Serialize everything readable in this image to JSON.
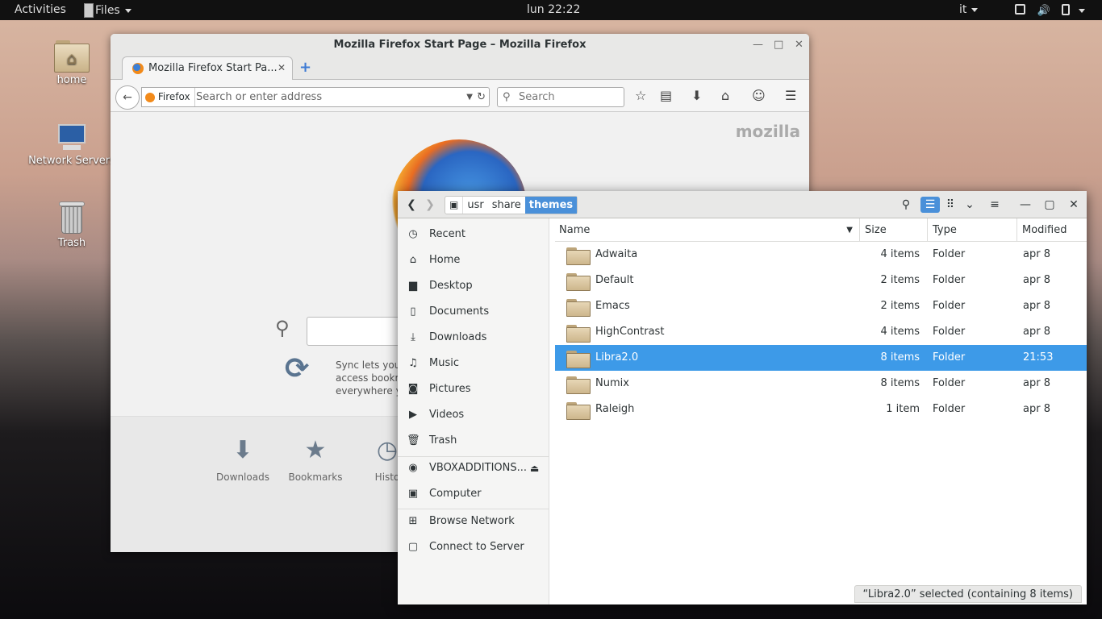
{
  "topbar": {
    "activities": "Activities",
    "app_menu": "Files",
    "clock": "lun 22:22",
    "lang": "it"
  },
  "desktop": {
    "icons": [
      {
        "label": "home"
      },
      {
        "label": "Network Servers"
      },
      {
        "label": "Trash"
      }
    ]
  },
  "firefox": {
    "title": "Mozilla Firefox Start Page – Mozilla Firefox",
    "tab_label": "Mozilla Firefox Start Pa...",
    "identity": "Firefox",
    "url_placeholder": "Search or enter address",
    "search_placeholder": "Search",
    "brand": "mozilla",
    "sync_text": [
      "Sync lets you s",
      "access bookma",
      "everywhere yo"
    ],
    "launchers": [
      "Downloads",
      "Bookmarks",
      "Histo"
    ]
  },
  "files": {
    "path": [
      "usr",
      "share",
      "themes"
    ],
    "sidebar": [
      {
        "label": "Recent",
        "icon": "recent-icon",
        "glyph": "◷"
      },
      {
        "label": "Home",
        "icon": "home-icon",
        "glyph": "⌂"
      },
      {
        "label": "Desktop",
        "icon": "desktop-icon",
        "glyph": "▆"
      },
      {
        "label": "Documents",
        "icon": "documents-icon",
        "glyph": "▯"
      },
      {
        "label": "Downloads",
        "icon": "downloads-icon",
        "glyph": "⤓"
      },
      {
        "label": "Music",
        "icon": "music-icon",
        "glyph": "♫"
      },
      {
        "label": "Pictures",
        "icon": "pictures-icon",
        "glyph": "◙"
      },
      {
        "label": "Videos",
        "icon": "videos-icon",
        "glyph": "▶"
      },
      {
        "label": "Trash",
        "icon": "trash-icon",
        "glyph": "🗑"
      },
      {
        "label": "VBOXADDITIONS...",
        "icon": "disc-icon",
        "glyph": "◉"
      },
      {
        "label": "Computer",
        "icon": "computer-icon",
        "glyph": "▣"
      },
      {
        "label": "Browse Network",
        "icon": "network-icon",
        "glyph": "⊞"
      },
      {
        "label": "Connect to Server",
        "icon": "server-icon",
        "glyph": "▢"
      }
    ],
    "columns": {
      "name": "Name",
      "size": "Size",
      "type": "Type",
      "modified": "Modified"
    },
    "rows": [
      {
        "name": "Adwaita",
        "size": "4 items",
        "type": "Folder",
        "modified": "apr 8"
      },
      {
        "name": "Default",
        "size": "2 items",
        "type": "Folder",
        "modified": "apr 8"
      },
      {
        "name": "Emacs",
        "size": "2 items",
        "type": "Folder",
        "modified": "apr 8"
      },
      {
        "name": "HighContrast",
        "size": "4 items",
        "type": "Folder",
        "modified": "apr 8"
      },
      {
        "name": "Libra2.0",
        "size": "8 items",
        "type": "Folder",
        "modified": "21:53",
        "selected": true
      },
      {
        "name": "Numix",
        "size": "8 items",
        "type": "Folder",
        "modified": "apr 8"
      },
      {
        "name": "Raleigh",
        "size": "1 item",
        "type": "Folder",
        "modified": "apr 8"
      }
    ],
    "status": "“Libra2.0” selected  (containing 8 items)"
  },
  "colors": {
    "accent": "#4a90d9",
    "selection": "#3d9ae8"
  }
}
